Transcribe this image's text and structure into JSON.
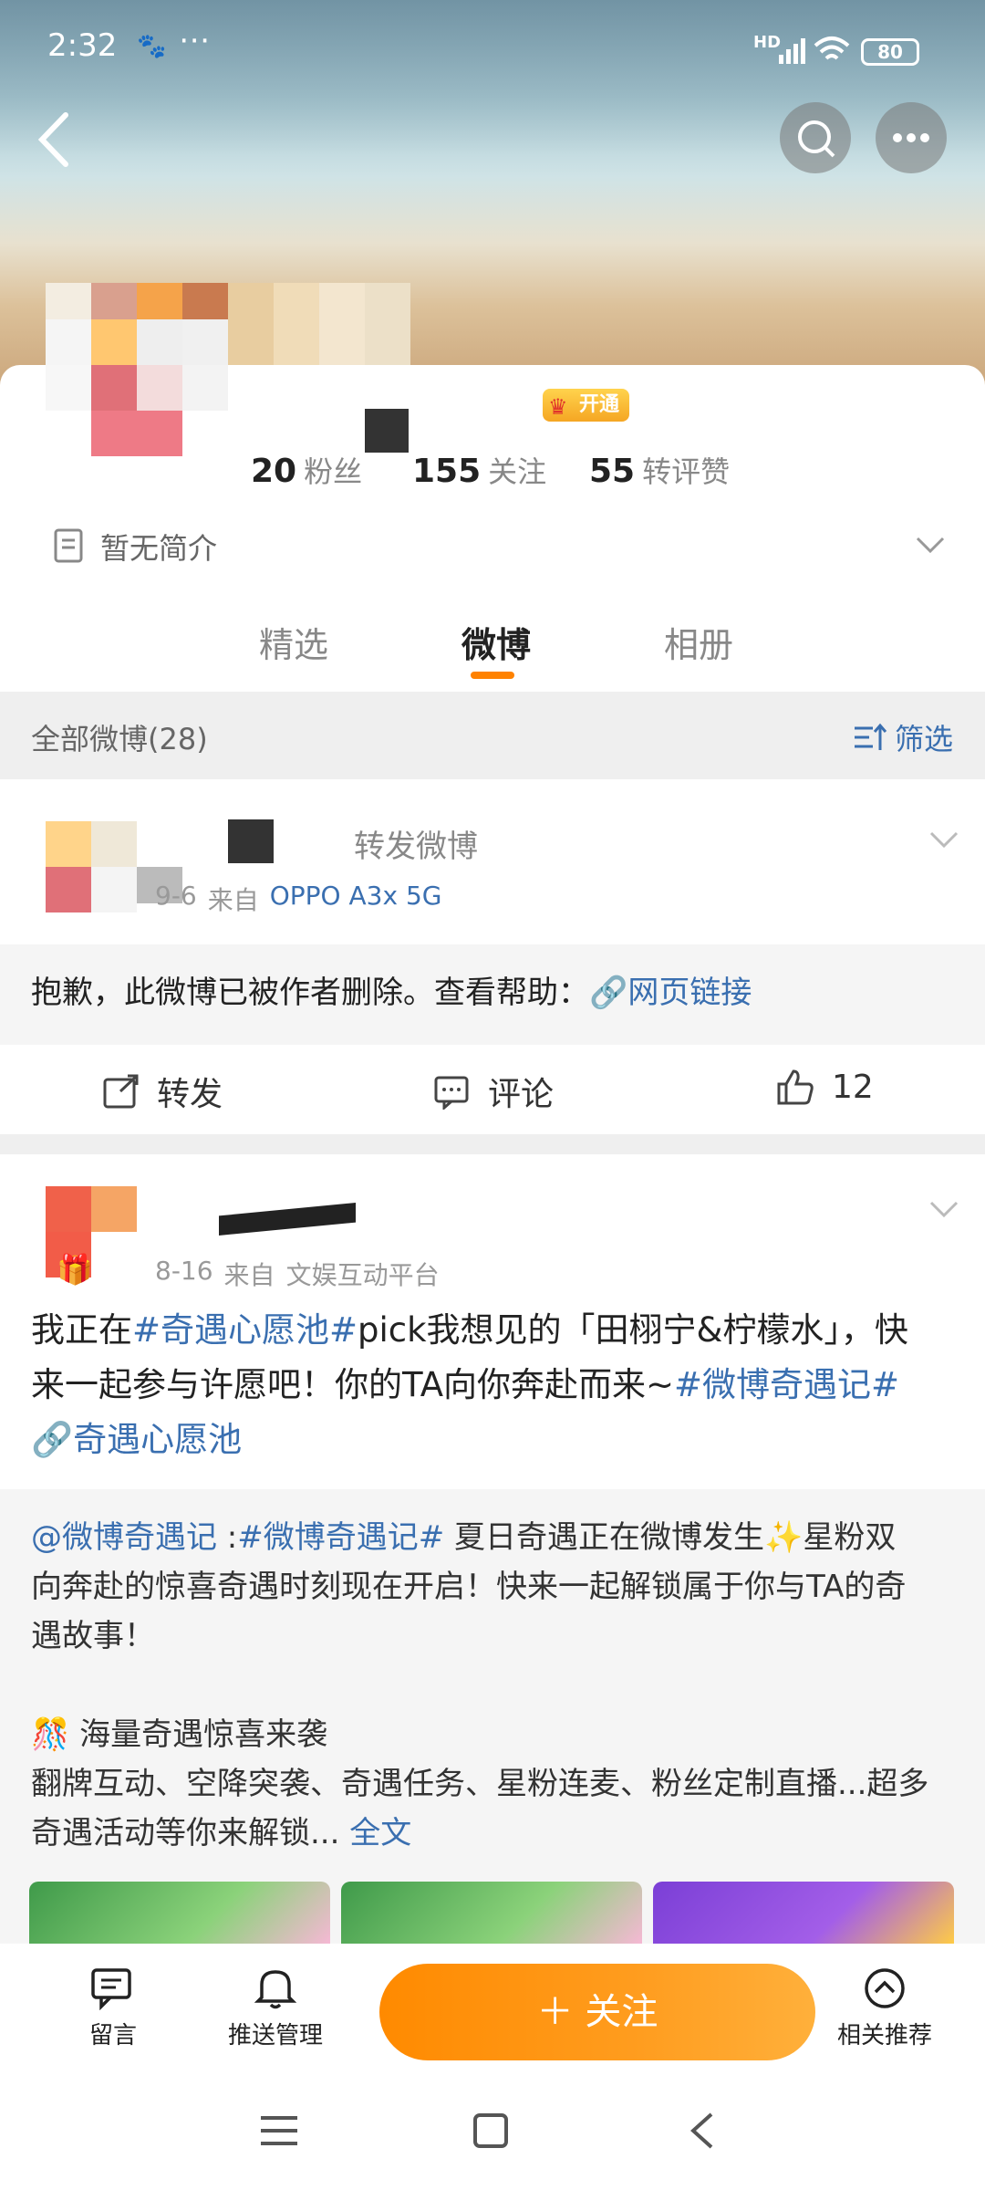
{
  "status_bar": {
    "time": "2:32",
    "extra": "⋯",
    "network": "HD",
    "battery": "80"
  },
  "header": {
    "vip_badge": "开通"
  },
  "stats": [
    {
      "num": "20",
      "label": "粉丝"
    },
    {
      "num": "155",
      "label": "关注"
    },
    {
      "num": "55",
      "label": "转评赞"
    }
  ],
  "bio": "暂无简介",
  "tabs": [
    "精选",
    "微博",
    "相册"
  ],
  "filter_bar": {
    "title": "全部微博(28)",
    "filter_label": "筛选"
  },
  "post1": {
    "type_label": "转发微博",
    "date": "9-6",
    "source_prefix": "来自",
    "source": "OPPO A3x 5G",
    "deleted_text": "抱歉，此微博已被作者删除。查看帮助：",
    "link_text": "网页链接",
    "repost_label": "转发",
    "comment_label": "评论",
    "like_count": "12"
  },
  "post2": {
    "date": "8-16",
    "source_prefix": "来自",
    "source": "文娱互动平台",
    "line1_a": "我正在",
    "tag1": "#奇遇心愿池#",
    "line1_b": "pick我想见的「田栩宁&柠檬水」，快",
    "line2_a": "来一起参与许愿吧！你的TA向你奔赴而来~",
    "tag2": "#微博奇遇记#",
    "link_line": "奇遇心愿池",
    "quote_user": "@微博奇遇记",
    "quote_sep": " :",
    "quote_tag": "#微博奇遇记#",
    "quote_line1_rest": " 夏日奇遇正在微博发生✨星粉双",
    "quote_line2": "向奔赴的惊喜奇遇时刻现在开启！快来一起解锁属于你与TA的奇",
    "quote_line3": "遇故事！",
    "quote_heading": "海量奇遇惊喜来袭",
    "quote_line4": "翻牌互动、空降突袭、奇遇任务、星粉连麦、粉丝定制直播...超多",
    "quote_line5": "奇遇活动等你来解锁...",
    "full_text": "全文"
  },
  "bottom_nav": {
    "message": "留言",
    "push": "推送管理",
    "follow": "＋ 关注",
    "related": "相关推荐"
  },
  "colors": {
    "accent": "#ff8200",
    "link": "#3a6fb0",
    "tab_underline": "#ff8200"
  }
}
